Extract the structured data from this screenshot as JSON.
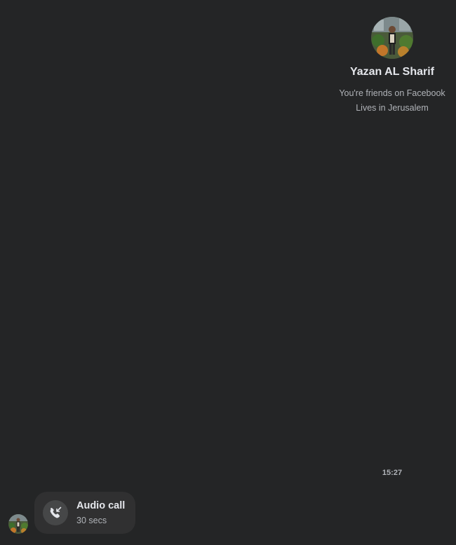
{
  "profile": {
    "name": "Yazan AL Sharif",
    "friendship": "You're friends on Facebook",
    "location": "Lives in Jerusalem"
  },
  "conversation": {
    "timestamp": "15:27",
    "call": {
      "title": "Audio call",
      "duration": "30 secs",
      "icon": "incoming-call-icon"
    }
  },
  "colors": {
    "background": "#242526",
    "bubble": "#303031",
    "icon_circle": "#464748",
    "primary_text": "#e4e6eb",
    "secondary_text": "#b0b3b8"
  }
}
